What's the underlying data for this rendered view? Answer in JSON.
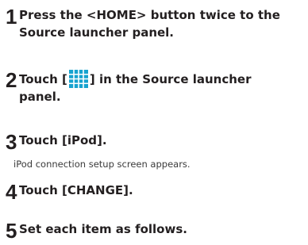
{
  "steps": [
    {
      "number": "1",
      "line1": "Press the <HOME> button twice to the",
      "line2": "Source launcher panel."
    },
    {
      "number": "2",
      "line1_before_icon": "Touch [",
      "icon": "grid-icon",
      "line1_after_icon": "] in the Source launcher",
      "line2": "panel."
    },
    {
      "number": "3",
      "line1": "Touch [iPod].",
      "note": "iPod connection setup screen appears."
    },
    {
      "number": "4",
      "line1": "Touch [CHANGE]."
    },
    {
      "number": "5",
      "line1": "Set each item as follows."
    }
  ],
  "colors": {
    "text": "#231f20",
    "icon_fill": "#17a3cf"
  }
}
